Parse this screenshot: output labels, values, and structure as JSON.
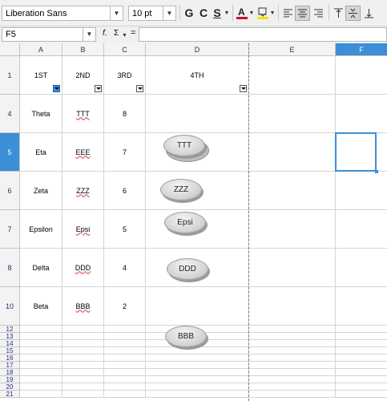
{
  "toolbar": {
    "font_name": "Liberation Sans",
    "font_size": "10 pt",
    "bold_label": "G",
    "italic_label": "C",
    "underline_label": "S"
  },
  "formula_bar": {
    "name_box": "F5",
    "function_symbol": "f.",
    "sum_symbol": "Σ",
    "equals_symbol": "=",
    "content": ""
  },
  "columns": [
    "A",
    "B",
    "C",
    "D",
    "E",
    "F"
  ],
  "selected_column": "F",
  "selected_row": "5",
  "header_row": {
    "row": "1",
    "cells": [
      "1ST",
      "2ND",
      "3RD",
      "4TH"
    ]
  },
  "rows": [
    {
      "row": "4",
      "a": "Theta",
      "b": "TTT",
      "c": "8"
    },
    {
      "row": "5",
      "a": "Eta",
      "b": "EEE",
      "c": "7"
    },
    {
      "row": "6",
      "a": "Zeta",
      "b": "ZZZ",
      "c": "6"
    },
    {
      "row": "7",
      "a": "Epsilon",
      "b": "Epsi",
      "c": "5"
    },
    {
      "row": "8",
      "a": "Delta",
      "b": "DDD",
      "c": "4"
    },
    {
      "row": "10",
      "a": "Beta",
      "b": "BBB",
      "c": "2"
    }
  ],
  "small_rows": [
    "12",
    "13",
    "14",
    "15",
    "16",
    "17",
    "18",
    "19",
    "20",
    "21"
  ],
  "shapes": [
    "TTT",
    "ZZZ",
    "Epsi",
    "DDD",
    "BBB"
  ],
  "colors": {
    "selection": "#3b8fd6",
    "font_color": "#c8102e",
    "highlight": "#f5e400",
    "spell_underline": "#d43a3a",
    "row_number": "#24307a"
  }
}
